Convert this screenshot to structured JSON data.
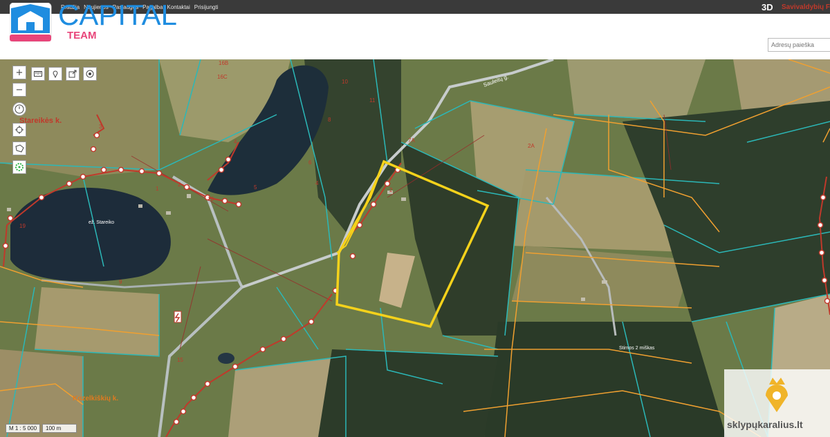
{
  "nav": [
    "Pradžia",
    "Naujienos",
    "Paslaugos",
    "Pagalba",
    "Kontaktai",
    "Prisijungti"
  ],
  "toolbar": {
    "btn_3d": "3D",
    "municipality": "Savivaldybių F"
  },
  "logo": {
    "title": "CAPITAL",
    "subtitle": "TEAM"
  },
  "search": {
    "placeholder": "Adresų paieška"
  },
  "map": {
    "places": [
      "Stareikės k.",
      "ež. Stareiko",
      "Kozelkiškių k.",
      "Stirnos 2 miškas",
      "Sauleitų g."
    ],
    "parcel_numbers": [
      "16B",
      "16C",
      "10",
      "11",
      "8",
      "6",
      "4",
      "7A",
      "2A",
      "2",
      "4",
      "3",
      "2",
      "5",
      "9",
      "15",
      "19",
      "1",
      "13"
    ],
    "selected_parcel_color": "#f5d21b",
    "parcel_line_color": "#2bb8b8",
    "cadastre_line_color": "#f0a030",
    "route_color": "#c0392b"
  },
  "map_tools": {
    "zoom_in": "+",
    "zoom_out": "−"
  },
  "scale": {
    "ratio": "M 1 : 5 000",
    "bar": "100 m"
  },
  "watermark": {
    "text": "sklypųkaralius.lt"
  }
}
